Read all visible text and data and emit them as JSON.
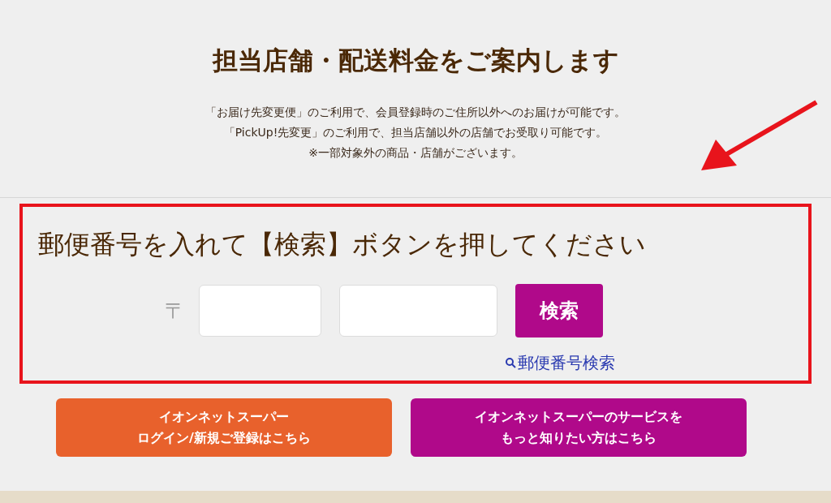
{
  "title": "担当店舗・配送料金をご案内します",
  "notes": [
    "「お届け先変更便」のご利用で、会員登録時のご住所以外へのお届けが可能です。",
    "「PickUp!先変更」のご利用で、担当店舗以外の店舗でお受取り可能です。",
    "※一部対象外の商品・店舗がございます。"
  ],
  "search": {
    "heading": "郵便番号を入れて【検索】ボタンを押してください",
    "postal_mark": "〒",
    "button": "検索",
    "lookup_link": "郵便番号検索"
  },
  "buttons": [
    {
      "lines": [
        "イオンネットスーパー",
        "ログイン/新規ご登録はこちら"
      ],
      "color": "#e8612c"
    },
    {
      "lines": [
        "イオンネットスーパーのサービスを",
        "もっと知りたい方はこちら"
      ],
      "color": "#b0098a"
    }
  ]
}
